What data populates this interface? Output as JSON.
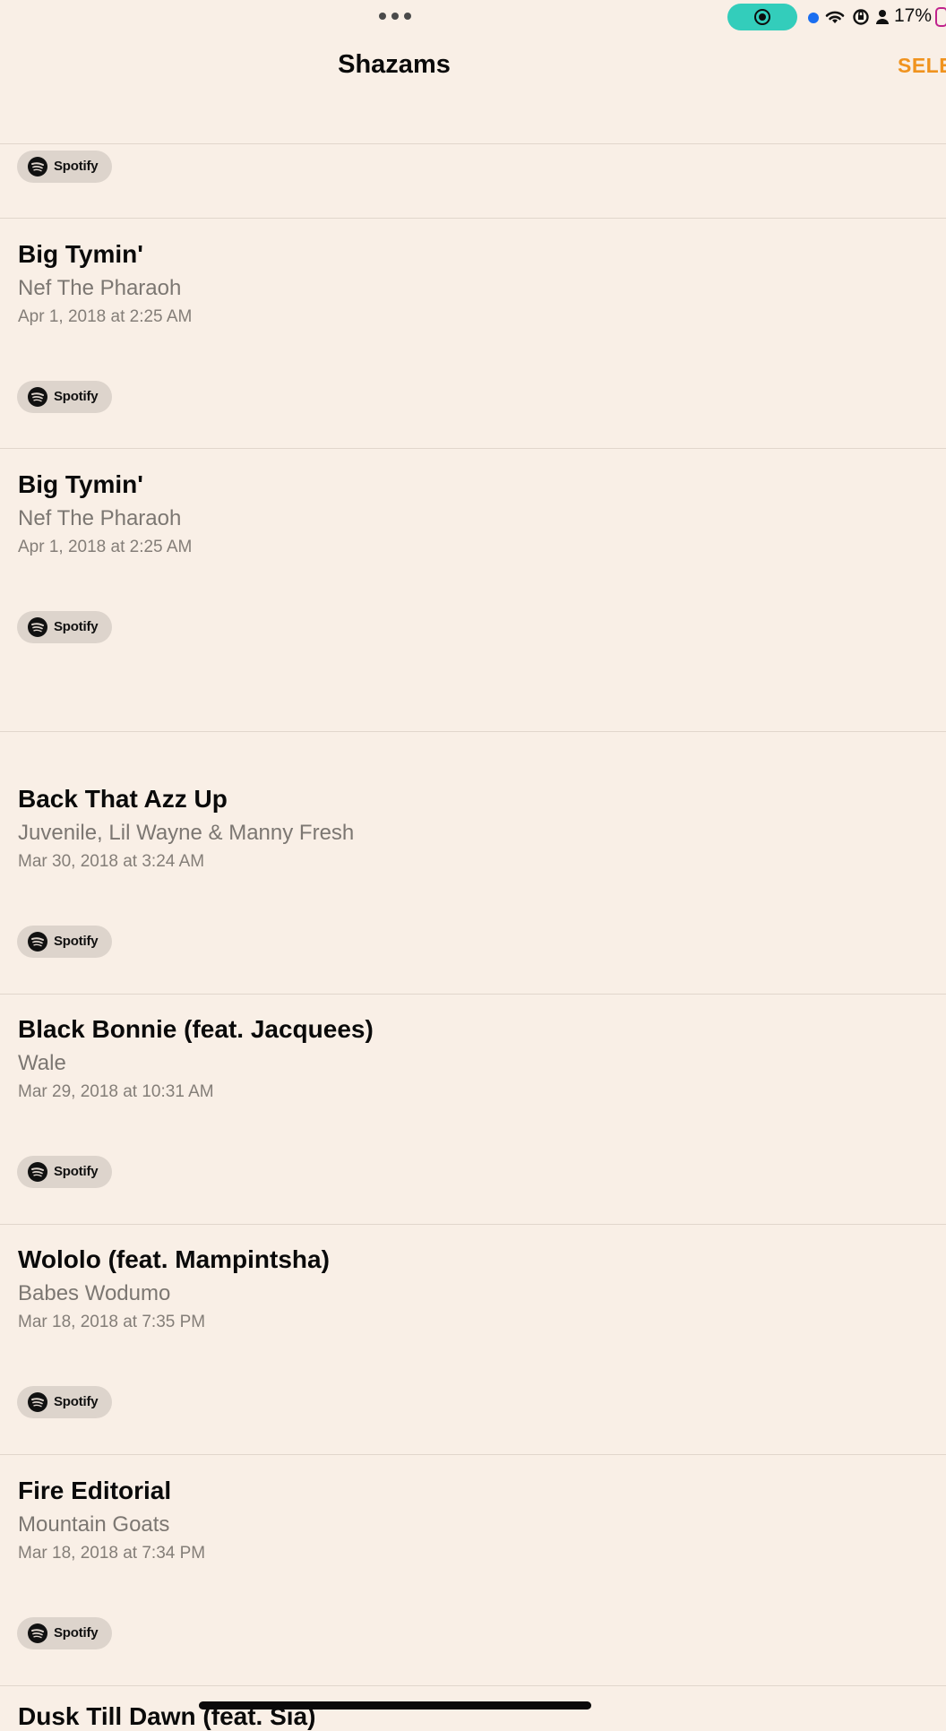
{
  "status_bar": {
    "battery_percent": "17%",
    "record_indicator_color": "#33cdbb",
    "mic_dot_color": "#1a6ef0",
    "icons": [
      "wifi-icon",
      "orientation-lock-icon",
      "person-icon",
      "battery-icon"
    ]
  },
  "nav": {
    "title": "Shazams",
    "select_label": "SELECT",
    "accent_color": "#f0931e"
  },
  "spotify_label": "Spotify",
  "items": [
    {
      "title": "Big Tymin'",
      "artist": "Nef The Pharaoh",
      "date": "Apr 1, 2018 at 2:25 AM"
    },
    {
      "title": "Big Tymin'",
      "artist": "Nef The Pharaoh",
      "date": "Apr 1, 2018 at 2:25 AM"
    },
    {
      "title": "Back That Azz Up",
      "artist": "Juvenile, Lil Wayne & Manny Fresh",
      "date": "Mar 30, 2018 at 3:24 AM"
    },
    {
      "title": "Black Bonnie (feat. Jacquees)",
      "artist": "Wale",
      "date": "Mar 29, 2018 at 10:31 AM"
    },
    {
      "title": "Wololo (feat. Mampintsha)",
      "artist": "Babes Wodumo",
      "date": "Mar 18, 2018 at 7:35 PM"
    },
    {
      "title": "Fire Editorial",
      "artist": "Mountain Goats",
      "date": "Mar 18, 2018 at 7:34 PM"
    }
  ],
  "partial_item_title": "Dusk Till Dawn (feat. Sia)"
}
